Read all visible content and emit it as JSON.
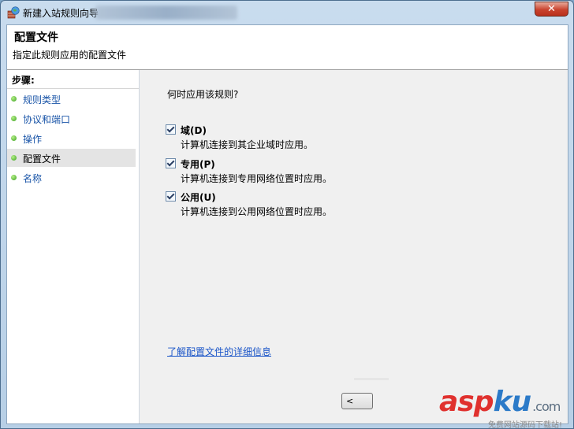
{
  "window": {
    "title": "新建入站规则向导",
    "close_label": "✕"
  },
  "header": {
    "title": "配置文件",
    "subtitle": "指定此规则应用的配置文件"
  },
  "steps": {
    "heading": "步骤:",
    "items": [
      {
        "label": "规则类型",
        "active": false
      },
      {
        "label": "协议和端口",
        "active": false
      },
      {
        "label": "操作",
        "active": false
      },
      {
        "label": "配置文件",
        "active": true
      },
      {
        "label": "名称",
        "active": false
      }
    ]
  },
  "main": {
    "question": "何时应用该规则?",
    "options": [
      {
        "label": "域(D)",
        "description": "计算机连接到其企业域时应用。",
        "checked": true
      },
      {
        "label": "专用(P)",
        "description": "计算机连接到专用网络位置时应用。",
        "checked": true
      },
      {
        "label": "公用(U)",
        "description": "计算机连接到公用网络位置时应用。",
        "checked": true
      }
    ],
    "learn_more": "了解配置文件的详细信息",
    "back_button": "<"
  },
  "watermark": {
    "asp": "asp",
    "ku": "ku",
    "domain": ".com",
    "caption": "免费网站源码下载站!"
  }
}
